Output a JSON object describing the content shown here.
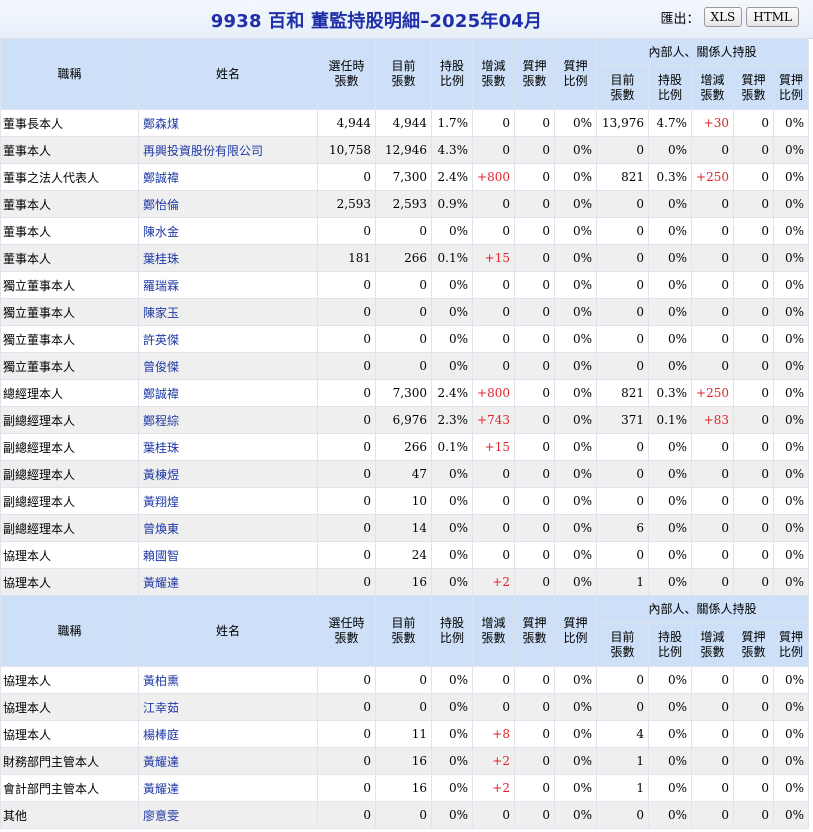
{
  "title": "9938 百和 董監持股明細–2025年04月",
  "export": {
    "label": "匯出：",
    "xls": "XLS",
    "html": "HTML"
  },
  "headers": {
    "title": "職稱",
    "name": "姓名",
    "elected": "選任時張數",
    "current": "目前張數",
    "ratio": "持股比例",
    "change": "增減張數",
    "pledged": "質押張數",
    "pledge_ratio": "質押比例",
    "insider_group": "內部人、關係人持股",
    "in_current": "目前張數",
    "in_ratio": "持股比例",
    "in_change": "增減張數",
    "in_pledged": "質押張數",
    "in_pledge_ratio": "質押比例"
  },
  "rows": [
    {
      "title": "董事長本人",
      "name": "鄭森煤",
      "cells": [
        "4,944",
        "4,944",
        "1.7%",
        "0",
        "0",
        "0%",
        "13,976",
        "4.7%",
        "+30",
        "0",
        "0%"
      ]
    },
    {
      "title": "董事本人",
      "name": "再興投資股份有限公司",
      "cells": [
        "10,758",
        "12,946",
        "4.3%",
        "0",
        "0",
        "0%",
        "0",
        "0%",
        "0",
        "0",
        "0%"
      ]
    },
    {
      "title": "董事之法人代表人",
      "name": "鄭誠禕",
      "cells": [
        "0",
        "7,300",
        "2.4%",
        "+800",
        "0",
        "0%",
        "821",
        "0.3%",
        "+250",
        "0",
        "0%"
      ]
    },
    {
      "title": "董事本人",
      "name": "鄭怡倫",
      "cells": [
        "2,593",
        "2,593",
        "0.9%",
        "0",
        "0",
        "0%",
        "0",
        "0%",
        "0",
        "0",
        "0%"
      ]
    },
    {
      "title": "董事本人",
      "name": "陳水金",
      "cells": [
        "0",
        "0",
        "0%",
        "0",
        "0",
        "0%",
        "0",
        "0%",
        "0",
        "0",
        "0%"
      ]
    },
    {
      "title": "董事本人",
      "name": "葉桂珠",
      "cells": [
        "181",
        "266",
        "0.1%",
        "+15",
        "0",
        "0%",
        "0",
        "0%",
        "0",
        "0",
        "0%"
      ]
    },
    {
      "title": "獨立董事本人",
      "name": "羅瑞霖",
      "cells": [
        "0",
        "0",
        "0%",
        "0",
        "0",
        "0%",
        "0",
        "0%",
        "0",
        "0",
        "0%"
      ]
    },
    {
      "title": "獨立董事本人",
      "name": "陳家玉",
      "cells": [
        "0",
        "0",
        "0%",
        "0",
        "0",
        "0%",
        "0",
        "0%",
        "0",
        "0",
        "0%"
      ]
    },
    {
      "title": "獨立董事本人",
      "name": "許英傑",
      "cells": [
        "0",
        "0",
        "0%",
        "0",
        "0",
        "0%",
        "0",
        "0%",
        "0",
        "0",
        "0%"
      ]
    },
    {
      "title": "獨立董事本人",
      "name": "曾俊傑",
      "cells": [
        "0",
        "0",
        "0%",
        "0",
        "0",
        "0%",
        "0",
        "0%",
        "0",
        "0",
        "0%"
      ]
    },
    {
      "title": "總經理本人",
      "name": "鄭誠禕",
      "cells": [
        "0",
        "7,300",
        "2.4%",
        "+800",
        "0",
        "0%",
        "821",
        "0.3%",
        "+250",
        "0",
        "0%"
      ]
    },
    {
      "title": "副總經理本人",
      "name": "鄭程綜",
      "cells": [
        "0",
        "6,976",
        "2.3%",
        "+743",
        "0",
        "0%",
        "371",
        "0.1%",
        "+83",
        "0",
        "0%"
      ]
    },
    {
      "title": "副總經理本人",
      "name": "葉桂珠",
      "cells": [
        "0",
        "266",
        "0.1%",
        "+15",
        "0",
        "0%",
        "0",
        "0%",
        "0",
        "0",
        "0%"
      ]
    },
    {
      "title": "副總經理本人",
      "name": "黃棟煜",
      "cells": [
        "0",
        "47",
        "0%",
        "0",
        "0",
        "0%",
        "0",
        "0%",
        "0",
        "0",
        "0%"
      ]
    },
    {
      "title": "副總經理本人",
      "name": "黃翔煌",
      "cells": [
        "0",
        "10",
        "0%",
        "0",
        "0",
        "0%",
        "0",
        "0%",
        "0",
        "0",
        "0%"
      ]
    },
    {
      "title": "副總經理本人",
      "name": "曾煥東",
      "cells": [
        "0",
        "14",
        "0%",
        "0",
        "0",
        "0%",
        "6",
        "0%",
        "0",
        "0",
        "0%"
      ]
    },
    {
      "title": "協理本人",
      "name": "賴國智",
      "cells": [
        "0",
        "24",
        "0%",
        "0",
        "0",
        "0%",
        "0",
        "0%",
        "0",
        "0",
        "0%"
      ]
    },
    {
      "title": "協理本人",
      "name": "黃耀達",
      "cells": [
        "0",
        "16",
        "0%",
        "+2",
        "0",
        "0%",
        "1",
        "0%",
        "0",
        "0",
        "0%"
      ]
    }
  ],
  "rows2": [
    {
      "title": "協理本人",
      "name": "黃柏熏",
      "cells": [
        "0",
        "0",
        "0%",
        "0",
        "0",
        "0%",
        "0",
        "0%",
        "0",
        "0",
        "0%"
      ]
    },
    {
      "title": "協理本人",
      "name": "江幸茹",
      "cells": [
        "0",
        "0",
        "0%",
        "0",
        "0",
        "0%",
        "0",
        "0%",
        "0",
        "0",
        "0%"
      ]
    },
    {
      "title": "協理本人",
      "name": "楊棒庭",
      "cells": [
        "0",
        "11",
        "0%",
        "+8",
        "0",
        "0%",
        "4",
        "0%",
        "0",
        "0",
        "0%"
      ]
    },
    {
      "title": "財務部門主管本人",
      "name": "黃耀達",
      "cells": [
        "0",
        "16",
        "0%",
        "+2",
        "0",
        "0%",
        "1",
        "0%",
        "0",
        "0",
        "0%"
      ]
    },
    {
      "title": "會計部門主管本人",
      "name": "黃耀達",
      "cells": [
        "0",
        "16",
        "0%",
        "+2",
        "0",
        "0%",
        "1",
        "0%",
        "0",
        "0",
        "0%"
      ]
    },
    {
      "title": "其他",
      "name": "廖意雯",
      "cells": [
        "0",
        "0",
        "0%",
        "0",
        "0",
        "0%",
        "0",
        "0%",
        "0",
        "0",
        "0%"
      ]
    }
  ],
  "colors": {
    "title": "#1f2fa8",
    "header_bg": "#cde0f7",
    "name_link": "#1f39a6",
    "positive": "#e0252a"
  }
}
